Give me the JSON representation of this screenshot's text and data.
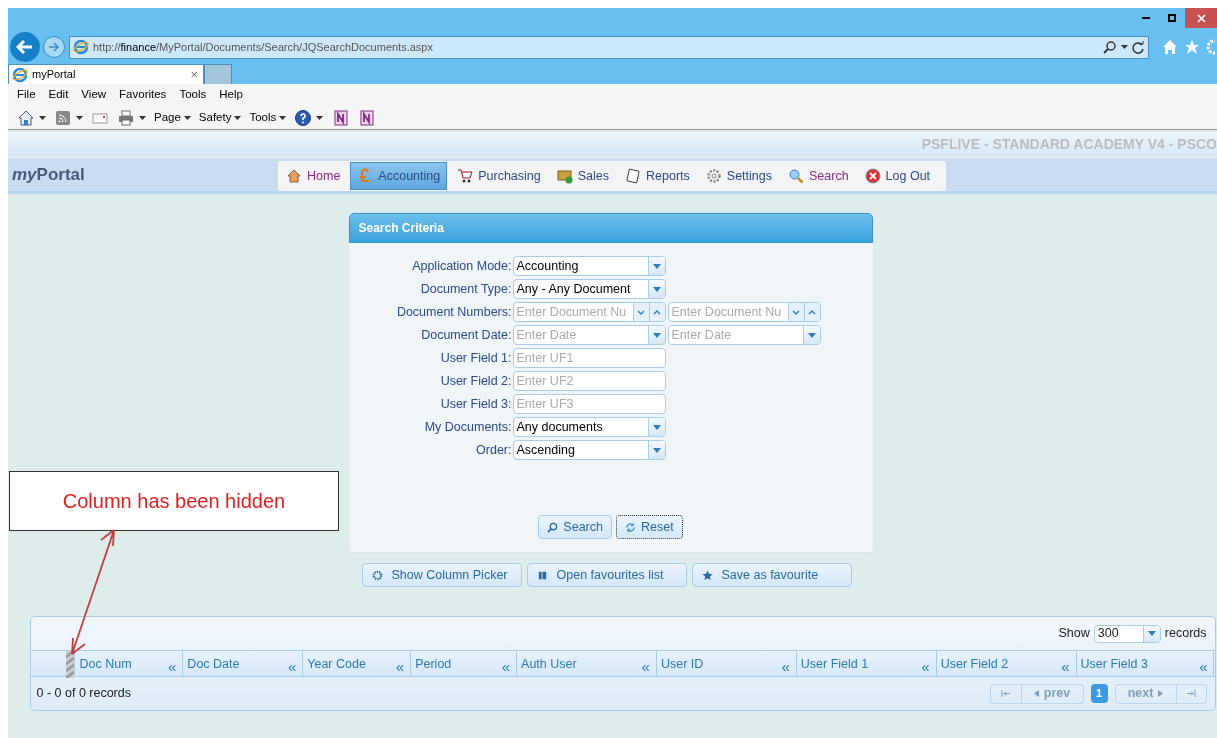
{
  "browser": {
    "address": {
      "prefix": "http://",
      "host": "finance",
      "path": "/MyPortal/Documents/Search/JQSearchDocuments.aspx"
    },
    "tabs": [
      {
        "label": "myPortal",
        "close": "×",
        "selected": true
      }
    ],
    "menu": [
      "File",
      "Edit",
      "View",
      "Favorites",
      "Tools",
      "Help"
    ],
    "command_bar": [
      {
        "kind": "menu",
        "label": "Page"
      },
      {
        "kind": "menu",
        "label": "Safety"
      },
      {
        "kind": "menu",
        "label": "Tools"
      }
    ]
  },
  "banner": "PSFLIVE - STANDARD ACADEMY V4 - PSCO",
  "logo": {
    "prefix": "my",
    "rest": "Portal"
  },
  "nav": [
    {
      "label": "Home",
      "selected": false,
      "visited": true
    },
    {
      "label": "Accounting",
      "selected": true,
      "visited": false
    },
    {
      "label": "Purchasing",
      "selected": false,
      "visited": false
    },
    {
      "label": "Sales",
      "selected": false,
      "visited": false
    },
    {
      "label": "Reports",
      "selected": false,
      "visited": false
    },
    {
      "label": "Settings",
      "selected": false,
      "visited": false
    },
    {
      "label": "Search",
      "selected": false,
      "visited": true
    },
    {
      "label": "Log Out",
      "selected": false,
      "visited": false
    }
  ],
  "search_criteria": {
    "title": "Search Criteria",
    "fields": [
      {
        "label": "Application Mode:",
        "kind": "select",
        "value": "Accounting"
      },
      {
        "label": "Document Type:",
        "kind": "select",
        "value": "Any - Any Document"
      },
      {
        "label": "Document Numbers:",
        "kind": "number_range",
        "from_placeholder": "Enter Document Nu",
        "to_placeholder": "Enter Document Nu"
      },
      {
        "label": "Document Date:",
        "kind": "date_range",
        "from_placeholder": "Enter Date",
        "to_placeholder": "Enter Date"
      },
      {
        "label": "User Field 1:",
        "kind": "text",
        "placeholder": "Enter UF1"
      },
      {
        "label": "User Field 2:",
        "kind": "text",
        "placeholder": "Enter UF2"
      },
      {
        "label": "User Field 3:",
        "kind": "text",
        "placeholder": "Enter UF3"
      },
      {
        "label": "My Documents:",
        "kind": "select",
        "value": "Any documents"
      },
      {
        "label": "Order:",
        "kind": "select",
        "value": "Ascending"
      }
    ],
    "buttons": [
      {
        "label": "Search",
        "focused": false
      },
      {
        "label": "Reset",
        "focused": true
      }
    ]
  },
  "actions": [
    {
      "label": "Show Column Picker"
    },
    {
      "label": "Open favourites list"
    },
    {
      "label": "Save as favourite"
    }
  ],
  "grid": {
    "show_label": "Show",
    "page_size": "300",
    "records_label": "records",
    "columns": [
      {
        "label": "Doc Num",
        "collapse": "«"
      },
      {
        "label": "Doc Date",
        "collapse": "«"
      },
      {
        "label": "Year Code",
        "collapse": "«"
      },
      {
        "label": "Period",
        "collapse": "«"
      },
      {
        "label": "Auth User",
        "collapse": "«"
      },
      {
        "label": "User ID",
        "collapse": "«"
      },
      {
        "label": "User Field 1",
        "collapse": "«"
      },
      {
        "label": "User Field 2",
        "collapse": "«"
      },
      {
        "label": "User Field 3",
        "collapse": "«"
      }
    ],
    "summary": "0 - 0 of 0 records",
    "pager": [
      {
        "kind": "first",
        "disabled": true
      },
      {
        "kind": "prev",
        "label": "prev",
        "disabled": true
      },
      {
        "kind": "page",
        "label": "1",
        "selected": true
      },
      {
        "kind": "next",
        "label": "next",
        "disabled": true
      },
      {
        "kind": "last",
        "disabled": true
      }
    ]
  },
  "annotation": {
    "text": "Column has been hidden"
  }
}
